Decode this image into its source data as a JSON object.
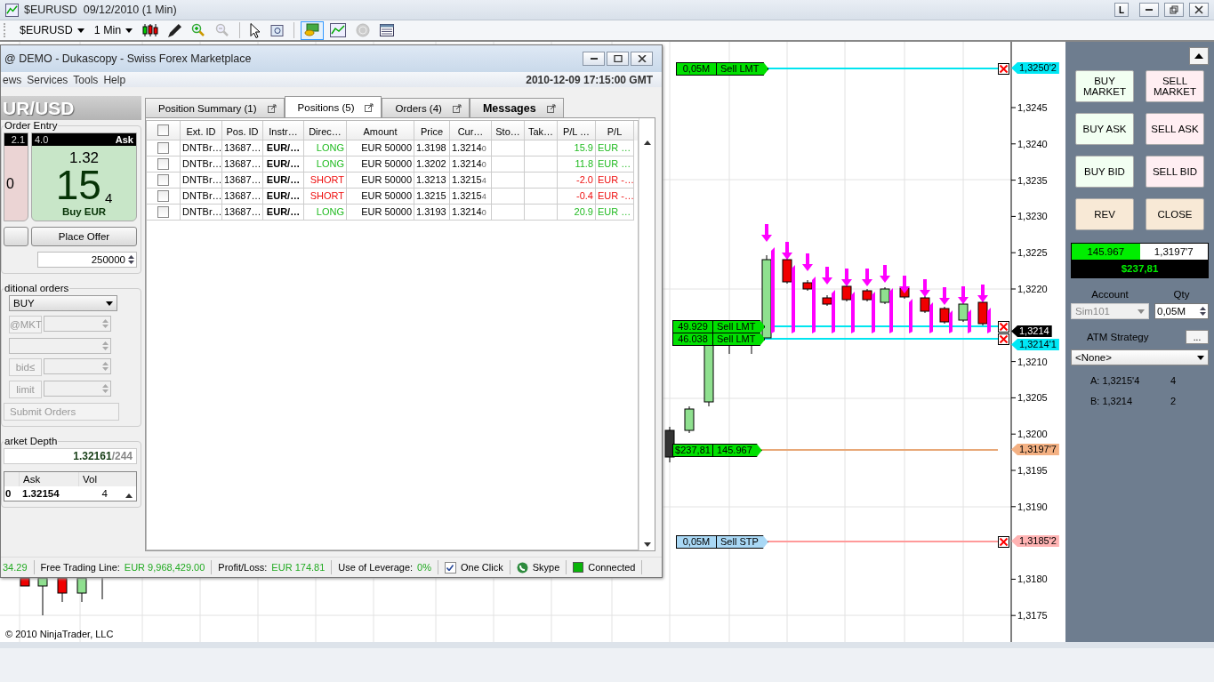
{
  "window": {
    "title": "$EURUSD  09/12/2010 (1 Min)",
    "title_button": "L"
  },
  "toolbar": {
    "instrument": "$EURUSD",
    "interval": "1 Min",
    "tools": [
      {
        "kind": "candles",
        "selected": false
      },
      {
        "kind": "pen",
        "selected": false
      },
      {
        "kind": "zoom-in",
        "selected": false
      },
      {
        "kind": "zoom-out",
        "selected": false
      },
      {
        "kind": "pointer",
        "selected": false
      },
      {
        "kind": "magnify",
        "selected": false
      },
      {
        "kind": "trade",
        "selected": true
      },
      {
        "kind": "chart",
        "selected": false
      },
      {
        "kind": "coin",
        "selected": false
      },
      {
        "kind": "table",
        "selected": false
      }
    ]
  },
  "chart": {
    "price_axis": [
      "1,3245",
      "1,3240",
      "1,3235",
      "1,3230",
      "1,3225",
      "1,3220",
      "1,3210",
      "1,3205",
      "1,3200",
      "1,3195",
      "1,3190",
      "1,3180",
      "1,3175"
    ],
    "price_markers": [
      {
        "text": "1,3250'2",
        "kind": "order"
      },
      {
        "text": "1,3214",
        "kind": "last"
      },
      {
        "text": "1,3214'1",
        "kind": "order"
      },
      {
        "text": "1,3197'7",
        "kind": "position"
      },
      {
        "text": "1,3185'2",
        "kind": "stop"
      }
    ],
    "order_lines": [
      {
        "qty": "0,05M",
        "label": "Sell LMT",
        "kind": "limit"
      },
      {
        "qty": "49.929",
        "label": "Sell LMT",
        "kind": "limit"
      },
      {
        "qty": "46.038",
        "label": "Sell LMT",
        "kind": "limit"
      },
      {
        "qty": "$237,81",
        "label": "145.967",
        "kind": "position"
      },
      {
        "qty": "0,05M",
        "label": "Sell STP",
        "kind": "stop"
      }
    ],
    "copyright": "© 2010 NinjaTrader, LLC"
  },
  "dukascopy": {
    "title": "@ DEMO - Dukascopy - Swiss Forex Marketplace",
    "menu": [
      "ews",
      "Services",
      "Tools",
      "Help"
    ],
    "datetime": "2010-12-09 17:15:00 GMT",
    "instrument": "UR/USD",
    "order_entry": {
      "title": "Order Entry",
      "bid": {
        "spread": "2.1",
        "digits": "0"
      },
      "ask": {
        "spread": "4.0",
        "label": "Ask",
        "big_figure": "1.32",
        "pips": "15",
        "fraction": "4",
        "action": "Buy EUR"
      },
      "place_button": "Place Offer",
      "amount": "250000"
    },
    "conditional": {
      "title": "ditional orders",
      "side": "BUY",
      "rows": [
        {
          "button": "@MKT"
        },
        {},
        {
          "button": "bid≤"
        },
        {
          "button": "limit"
        }
      ],
      "submit": "Submit Orders",
      "submit_disabled": true
    },
    "market_depth": {
      "title": "arket Depth",
      "quote": "1.32161",
      "quote_tail": "/244",
      "columns": [
        "Ask",
        "Vol"
      ],
      "rows": [
        {
          "bid": "0",
          "ask": "1.32154",
          "vol": "4"
        }
      ]
    },
    "tabs": [
      {
        "label": "Position Summary (1)",
        "selected": false,
        "bold": false
      },
      {
        "label": "Positions (5)",
        "selected": true,
        "bold": false
      },
      {
        "label": "Orders (4)",
        "selected": false,
        "bold": false
      },
      {
        "label": "Messages",
        "selected": false,
        "bold": true
      }
    ],
    "table": {
      "header_checked": false,
      "columns": [
        "Ext. ID",
        "Pos. ID",
        "Instr…",
        "Direc…",
        "Amount",
        "Price",
        "Cur…",
        "Sto…",
        "Tak…",
        "P/L …",
        "P/L"
      ],
      "rows": [
        {
          "checked": false,
          "ext": "DNTBr…",
          "pos": "13687…",
          "instr": "EUR/…",
          "direction": "LONG",
          "long": true,
          "amount": "EUR 50000",
          "price": "1.3198",
          "current": "1.3214",
          "pip": "0",
          "pl": "15.9",
          "pl_ccy": "EUR …",
          "profit": true
        },
        {
          "checked": false,
          "ext": "DNTBr…",
          "pos": "13687…",
          "instr": "EUR/…",
          "direction": "LONG",
          "long": true,
          "amount": "EUR 50000",
          "price": "1.3202",
          "current": "1.3214",
          "pip": "0",
          "pl": "11.8",
          "pl_ccy": "EUR …",
          "profit": true
        },
        {
          "checked": false,
          "ext": "DNTBr…",
          "pos": "13687…",
          "instr": "EUR/…",
          "direction": "SHORT",
          "long": false,
          "amount": "EUR 50000",
          "price": "1.3213",
          "current": "1.3215",
          "pip": "4",
          "pl": "-2.0",
          "pl_ccy": "EUR -…",
          "profit": false
        },
        {
          "checked": false,
          "ext": "DNTBr…",
          "pos": "13687…",
          "instr": "EUR/…",
          "direction": "SHORT",
          "long": false,
          "amount": "EUR 50000",
          "price": "1.3215",
          "current": "1.3215",
          "pip": "4",
          "pl": "-0.4",
          "pl_ccy": "EUR -…",
          "profit": false
        },
        {
          "checked": false,
          "ext": "DNTBr…",
          "pos": "13687…",
          "instr": "EUR/…",
          "direction": "LONG",
          "long": true,
          "amount": "EUR 50000",
          "price": "1.3193",
          "current": "1.3214",
          "pip": "0",
          "pl": "20.9",
          "pl_ccy": "EUR …",
          "profit": true
        }
      ]
    },
    "status": {
      "balance_tail": "34.29",
      "free_label": "Free Trading Line:",
      "free_value": "EUR 9,968,429.00",
      "pl_label": "Profit/Loss:",
      "pl_value": "EUR 174.81",
      "lev_label": "Use of Leverage:",
      "lev_value": "0%",
      "one_click": {
        "label": "One Click",
        "checked": true
      },
      "skype": "Skype",
      "connection": {
        "label": "Connected",
        "on": true
      }
    }
  },
  "panel": {
    "buttons": [
      {
        "label": "BUY MARKET",
        "kind": "buy"
      },
      {
        "label": "SELL MARKET",
        "kind": "sell"
      },
      {
        "label": "BUY ASK",
        "kind": "buy"
      },
      {
        "label": "SELL ASK",
        "kind": "sell"
      },
      {
        "label": "BUY BID",
        "kind": "buy"
      },
      {
        "label": "SELL BID",
        "kind": "sell"
      },
      {
        "label": "REV",
        "kind": "neutral"
      },
      {
        "label": "CLOSE",
        "kind": "neutral"
      }
    ],
    "position": {
      "qty": "145.967",
      "price": "1,3197'7",
      "pnl": "$237,81"
    },
    "account_label": "Account",
    "account": "Sim101",
    "qty_label": "Qty",
    "qty": "0,05M",
    "atm_label": "ATM Strategy",
    "atm_button": "...",
    "atm": "<None>",
    "quotes": [
      {
        "price": "A: 1,3215'4",
        "size": "4"
      },
      {
        "price": "B: 1,3214",
        "size": "2"
      }
    ]
  }
}
